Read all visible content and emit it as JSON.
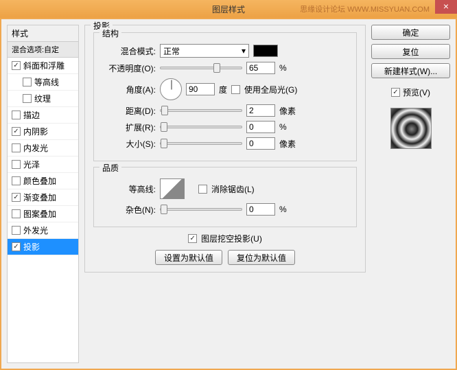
{
  "window": {
    "title": "图层样式",
    "watermark": "思缘设计论坛 WWW.MISSYUAN.COM"
  },
  "left": {
    "header": "样式",
    "sub": "混合选项:自定",
    "items": [
      {
        "label": "斜面和浮雕",
        "checked": true,
        "indent": false
      },
      {
        "label": "等高线",
        "checked": false,
        "indent": true
      },
      {
        "label": "纹理",
        "checked": false,
        "indent": true
      },
      {
        "label": "描边",
        "checked": false,
        "indent": false
      },
      {
        "label": "内阴影",
        "checked": true,
        "indent": false
      },
      {
        "label": "内发光",
        "checked": false,
        "indent": false
      },
      {
        "label": "光泽",
        "checked": false,
        "indent": false
      },
      {
        "label": "颜色叠加",
        "checked": false,
        "indent": false
      },
      {
        "label": "渐变叠加",
        "checked": true,
        "indent": false
      },
      {
        "label": "图案叠加",
        "checked": false,
        "indent": false
      },
      {
        "label": "外发光",
        "checked": false,
        "indent": false
      },
      {
        "label": "投影",
        "checked": true,
        "indent": false,
        "selected": true
      }
    ]
  },
  "mid": {
    "section_title": "投影",
    "structure": {
      "legend": "结构",
      "blend_label": "混合模式:",
      "blend_value": "正常",
      "opacity_label": "不透明度(O):",
      "opacity_value": "65",
      "opacity_unit": "%",
      "angle_label": "角度(A):",
      "angle_value": "90",
      "angle_unit": "度",
      "global_label": "使用全局光(G)",
      "global_checked": false,
      "distance_label": "距离(D):",
      "distance_value": "2",
      "distance_unit": "像素",
      "spread_label": "扩展(R):",
      "spread_value": "0",
      "spread_unit": "%",
      "size_label": "大小(S):",
      "size_value": "0",
      "size_unit": "像素"
    },
    "quality": {
      "legend": "品质",
      "contour_label": "等高线:",
      "antialias_label": "消除锯齿(L)",
      "antialias_checked": false,
      "noise_label": "杂色(N):",
      "noise_value": "0",
      "noise_unit": "%"
    },
    "knockout": {
      "label": "图层挖空投影(U)",
      "checked": true
    },
    "buttons": {
      "default": "设置为默认值",
      "reset": "复位为默认值"
    }
  },
  "right": {
    "ok": "确定",
    "cancel": "复位",
    "newstyle": "新建样式(W)...",
    "preview_label": "预览(V)",
    "preview_checked": true
  }
}
